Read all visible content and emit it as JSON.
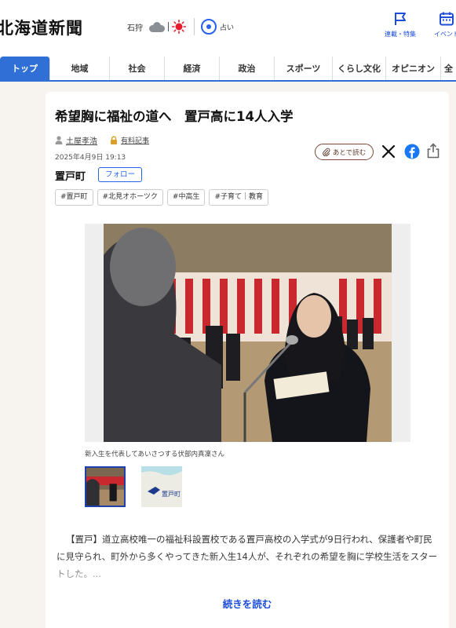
{
  "header": {
    "logo_text": "北海道新聞",
    "weather_city": "石狩",
    "weather_icons": [
      "cloud-icon",
      "sun-icon"
    ],
    "fortune_label": "占い",
    "buttons": [
      {
        "label": "連載・特集",
        "icon": "flag-icon"
      },
      {
        "label": "イベント",
        "icon": "calendar-icon"
      }
    ]
  },
  "nav": {
    "items": [
      "トップ",
      "地域",
      "社会",
      "経済",
      "政治",
      "スポーツ",
      "くらし文化",
      "オピニオン",
      "全"
    ],
    "active_index": 0
  },
  "article": {
    "title": "希望胸に福祉の道へ　置戸高に14人入学",
    "author": "土屋孝浩",
    "paid_label": "有料記事",
    "date": "2025年4月9日 19:13",
    "read_later_label": "あとで読む",
    "share_icons": [
      "x-icon",
      "facebook-icon",
      "share-icon"
    ],
    "town": "置戸町",
    "follow_label": "フォロー",
    "tags": [
      "#置戸町",
      "#北見オホーツク",
      "#中高生",
      "#子育て｜教育"
    ],
    "photo_caption": "新入生を代表してあいさつする伏部内真凜さん",
    "map_label": "置戸町",
    "body": "【置戸】道立高校唯一の福祉科設置校である置戸高校の入学式が9日行われ、保護者や町民に見守られ、町外から多くやってきた新入生14人が、それぞれの希望を胸に学校生活をスタートした。...",
    "read_more_label": "続きを読む"
  },
  "colors": {
    "accent": "#2f6fd6",
    "link": "#1d4ed8",
    "background": "#f7f3ee"
  }
}
